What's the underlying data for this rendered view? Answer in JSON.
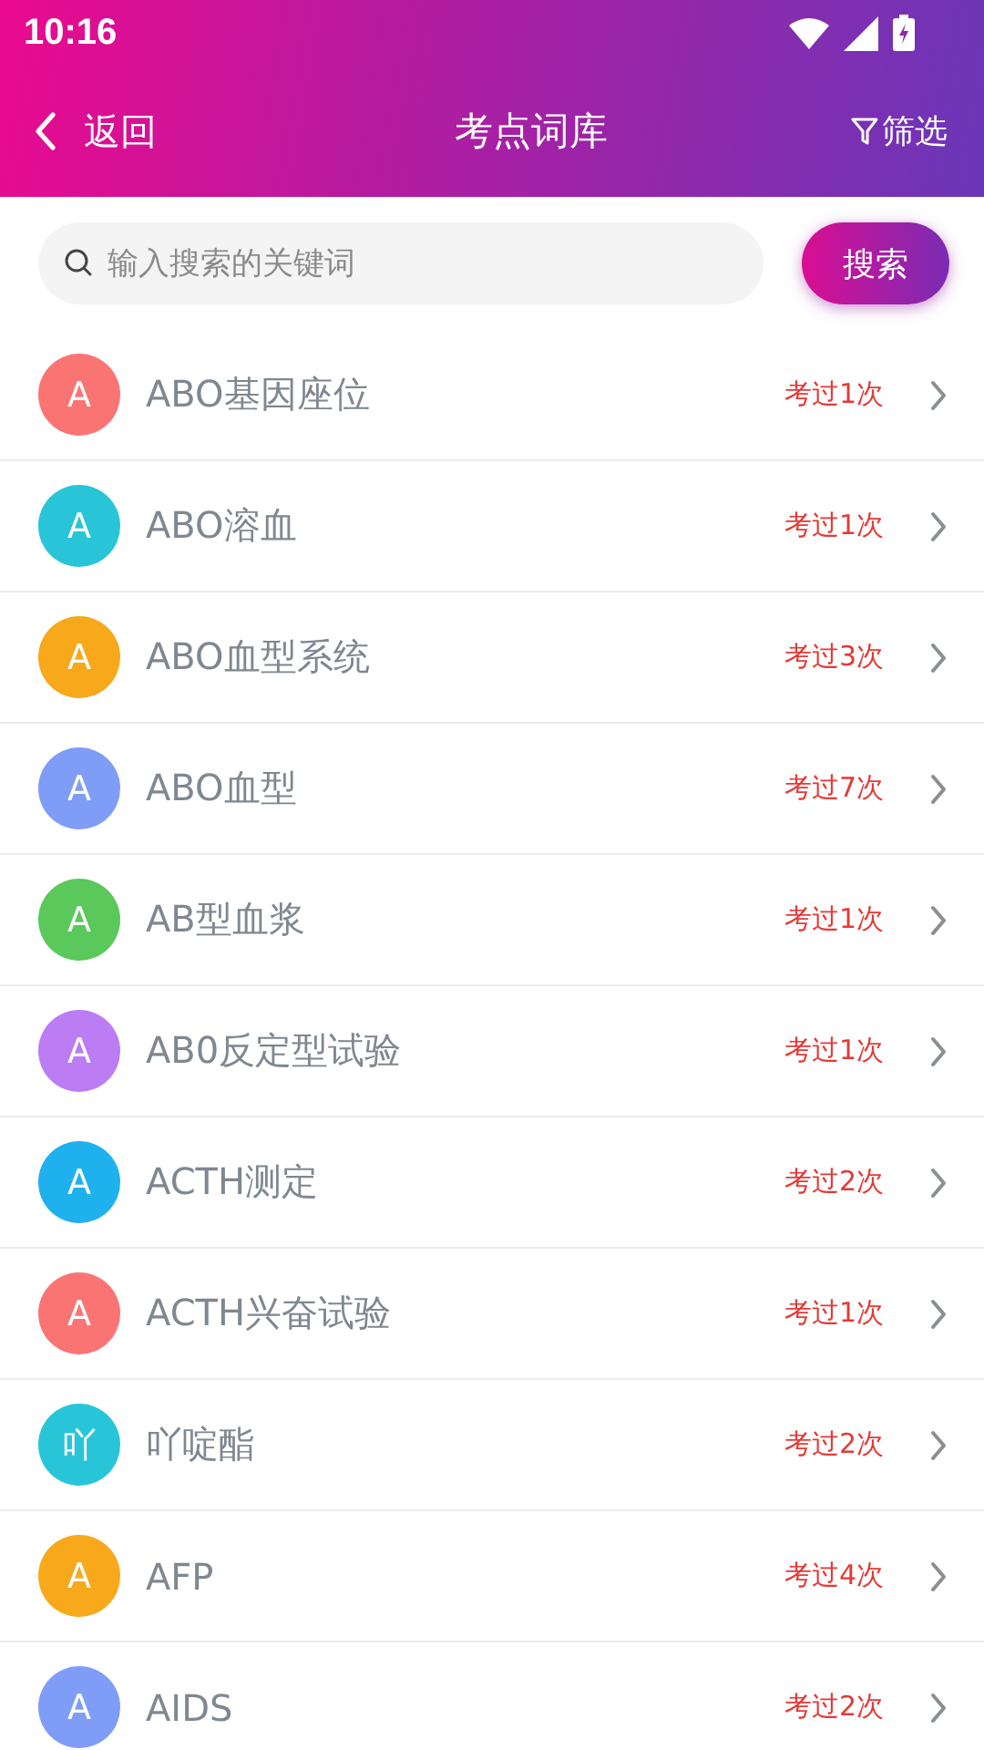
{
  "status_bar": {
    "time": "10:16"
  },
  "header": {
    "back": "返回",
    "title": "考点词库",
    "filter": "筛选"
  },
  "search": {
    "placeholder": "输入搜索的关键词",
    "button": "搜索"
  },
  "items": [
    {
      "initial": "A",
      "color": "#fb7474",
      "name": "ABO基因座位",
      "count": "考过1次"
    },
    {
      "initial": "A",
      "color": "#28c5d8",
      "name": "ABO溶血",
      "count": "考过1次"
    },
    {
      "initial": "A",
      "color": "#f7a81b",
      "name": "ABO血型系统",
      "count": "考过3次"
    },
    {
      "initial": "A",
      "color": "#7f9df7",
      "name": "ABO血型",
      "count": "考过7次"
    },
    {
      "initial": "A",
      "color": "#5ac85a",
      "name": "AB型血浆",
      "count": "考过1次"
    },
    {
      "initial": "A",
      "color": "#bb7cf4",
      "name": "AB0反定型试验",
      "count": "考过1次"
    },
    {
      "initial": "A",
      "color": "#1fb1ee",
      "name": "ACTH测定",
      "count": "考过2次"
    },
    {
      "initial": "A",
      "color": "#fb7474",
      "name": "ACTH兴奋试验",
      "count": "考过1次"
    },
    {
      "initial": "吖",
      "color": "#28c5d8",
      "name": "吖啶酯",
      "count": "考过2次"
    },
    {
      "initial": "A",
      "color": "#f7a81b",
      "name": "AFP",
      "count": "考过4次"
    },
    {
      "initial": "A",
      "color": "#7f9df7",
      "name": "AIDS",
      "count": "考过2次"
    }
  ]
}
